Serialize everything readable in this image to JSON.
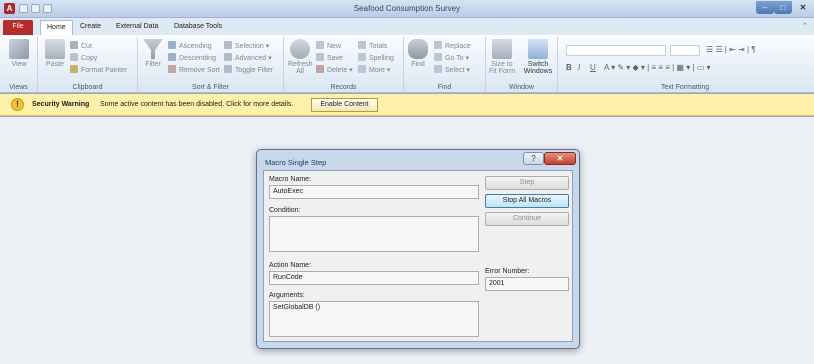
{
  "window": {
    "app_icon_letter": "A",
    "title": "Seafood Consumption Survey",
    "minimize": "–",
    "maximize": "□",
    "close": "✕"
  },
  "tabs": [
    {
      "label": "File"
    },
    {
      "label": "Home"
    },
    {
      "label": "Create"
    },
    {
      "label": "External Data"
    },
    {
      "label": "Database Tools"
    }
  ],
  "ribbon": {
    "views": {
      "view_label": "View",
      "group_label": "Views"
    },
    "clipboard": {
      "paste_label": "Paste",
      "cut": "Cut",
      "copy": "Copy",
      "format_painter": "Format Painter",
      "group_label": "Clipboard"
    },
    "sort_filter": {
      "filter_label": "Filter",
      "ascending": "Ascending",
      "descending": "Descending",
      "remove_sort": "Remove Sort",
      "selection": "Selection",
      "advanced": "Advanced",
      "toggle_filter": "Toggle Filter",
      "group_label": "Sort & Filter"
    },
    "records": {
      "refresh_label": "Refresh All",
      "new": "New",
      "save": "Save",
      "delete": "Delete",
      "totals": "Totals",
      "spelling": "Spelling",
      "more": "More",
      "group_label": "Records"
    },
    "find": {
      "find_label": "Find",
      "replace": "Replace",
      "go_to": "Go To",
      "select": "Select",
      "group_label": "Find"
    },
    "window": {
      "size_to_fit": "Size to Fit Form",
      "switch_windows": "Switch Windows",
      "group_label": "Window"
    },
    "text_formatting": {
      "bold": "B",
      "italic": "I",
      "underline": "U",
      "group_label": "Text Formatting"
    }
  },
  "security_bar": {
    "title": "Security Warning",
    "message": "Some active content has been disabled. Click for more details.",
    "enable_button": "Enable Content"
  },
  "dialog": {
    "title": "Macro Single Step",
    "help": "?",
    "close": "✕",
    "macro_name_label": "Macro Name:",
    "macro_name_value": "AutoExec",
    "condition_label": "Condition:",
    "condition_value": "",
    "action_name_label": "Action Name:",
    "action_name_value": "RunCode",
    "arguments_label": "Arguments:",
    "arguments_value": "SetGlobalDB ()",
    "error_number_label": "Error Number:",
    "error_number_value": "2001",
    "step_button": "Step",
    "stop_all_button": "Stop All Macros",
    "continue_button": "Continue"
  }
}
